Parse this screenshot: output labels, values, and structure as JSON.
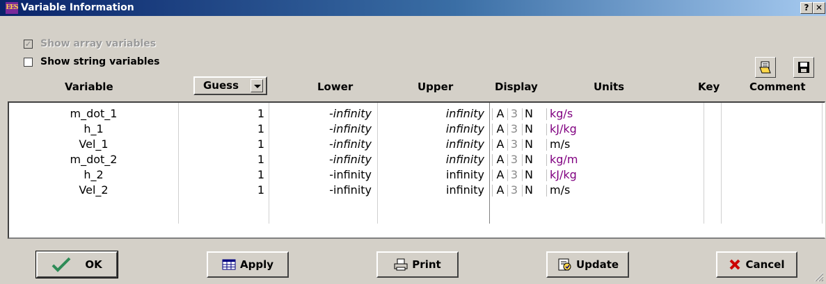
{
  "window": {
    "title": "Variable Information",
    "help_button": "?",
    "close_button": "✕"
  },
  "options": {
    "show_array_label": "Show array variables",
    "show_array_checked": true,
    "show_array_disabled": true,
    "show_string_label": "Show string variables",
    "show_string_checked": false
  },
  "headers": {
    "variable": "Variable",
    "guess": "Guess",
    "lower": "Lower",
    "upper": "Upper",
    "display": "Display",
    "units": "Units",
    "key": "Key",
    "comment": "Comment"
  },
  "rows": [
    {
      "variable": "m_dot_1",
      "guess": "1",
      "lower": "-infinity",
      "upper": "infinity",
      "fmt": "A",
      "digits": "3",
      "n": "N",
      "units": "kg/s",
      "italic": true,
      "units_color": "#800080"
    },
    {
      "variable": "h_1",
      "guess": "1",
      "lower": "-infinity",
      "upper": "infinity",
      "fmt": "A",
      "digits": "3",
      "n": "N",
      "units": "kJ/kg",
      "italic": true,
      "units_color": "#800080"
    },
    {
      "variable": "Vel_1",
      "guess": "1",
      "lower": "-infinity",
      "upper": "infinity",
      "fmt": "A",
      "digits": "3",
      "n": "N",
      "units": "m/s",
      "italic": true,
      "units_color": "#000000"
    },
    {
      "variable": "m_dot_2",
      "guess": "1",
      "lower": "-infinity",
      "upper": "infinity",
      "fmt": "A",
      "digits": "3",
      "n": "N",
      "units": "kg/m",
      "italic": true,
      "units_color": "#800080"
    },
    {
      "variable": "h_2",
      "guess": "1",
      "lower": "-infinity",
      "upper": "infinity",
      "fmt": "A",
      "digits": "3",
      "n": "N",
      "units": "kJ/kg",
      "italic": false,
      "units_color": "#800080"
    },
    {
      "variable": "Vel_2",
      "guess": "1",
      "lower": "-infinity",
      "upper": "infinity",
      "fmt": "A",
      "digits": "3",
      "n": "N",
      "units": "m/s",
      "italic": false,
      "units_color": "#000000"
    }
  ],
  "buttons": {
    "ok": "OK",
    "apply": "Apply",
    "print": "Print",
    "update": "Update",
    "cancel": "Cancel"
  },
  "icons": {
    "open": "open-folder-icon",
    "save": "floppy-disk-icon",
    "ok": "checkmark-icon",
    "apply": "table-icon",
    "print": "printer-icon",
    "update": "update-icon",
    "cancel": "x-mark-icon"
  },
  "colors": {
    "title_gradient_start": "#0a246a",
    "title_gradient_end": "#a6caf0",
    "units_purple": "#800080",
    "ok_green": "#2e8b57",
    "cancel_red": "#cc0000"
  }
}
